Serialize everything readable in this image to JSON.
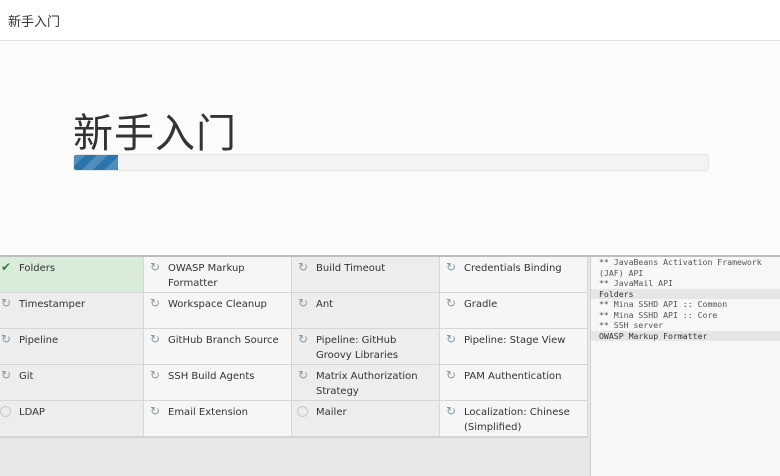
{
  "topbar": {
    "title": "新手入门"
  },
  "hero": {
    "title": "新手入门",
    "progress": 0.07,
    "progress_color": "#2b75ad"
  },
  "plugins": [
    {
      "name": "Folders",
      "status": "installed"
    },
    {
      "name": "OWASP Markup Formatter",
      "status": "installing"
    },
    {
      "name": "Build Timeout",
      "status": "installing"
    },
    {
      "name": "Credentials Binding",
      "status": "installing"
    },
    {
      "name": "Timestamper",
      "status": "installing"
    },
    {
      "name": "Workspace Cleanup",
      "status": "installing"
    },
    {
      "name": "Ant",
      "status": "installing"
    },
    {
      "name": "Gradle",
      "status": "installing"
    },
    {
      "name": "Pipeline",
      "status": "installing"
    },
    {
      "name": "GitHub Branch Source",
      "status": "installing"
    },
    {
      "name": "Pipeline: GitHub Groovy Libraries",
      "status": "installing"
    },
    {
      "name": "Pipeline: Stage View",
      "status": "installing"
    },
    {
      "name": "Git",
      "status": "installing"
    },
    {
      "name": "SSH Build Agents",
      "status": "installing"
    },
    {
      "name": "Matrix Authorization Strategy",
      "status": "installing"
    },
    {
      "name": "PAM Authentication",
      "status": "installing"
    },
    {
      "name": "LDAP",
      "status": "pending"
    },
    {
      "name": "Email Extension",
      "status": "installing"
    },
    {
      "name": "Mailer",
      "status": "pending"
    },
    {
      "name": "Localization: Chinese (Simplified)",
      "status": "installing"
    }
  ],
  "log": [
    {
      "text": "** JavaBeans Activation Framework (JAF) API",
      "highlight": false
    },
    {
      "text": "** JavaMail API",
      "highlight": false
    },
    {
      "text": "Folders",
      "highlight": true
    },
    {
      "text": "** Mina SSHD API :: Common",
      "highlight": false
    },
    {
      "text": "** Mina SSHD API :: Core",
      "highlight": false
    },
    {
      "text": "** SSH server",
      "highlight": false
    },
    {
      "text": "OWASP Markup Formatter",
      "highlight": true
    }
  ]
}
